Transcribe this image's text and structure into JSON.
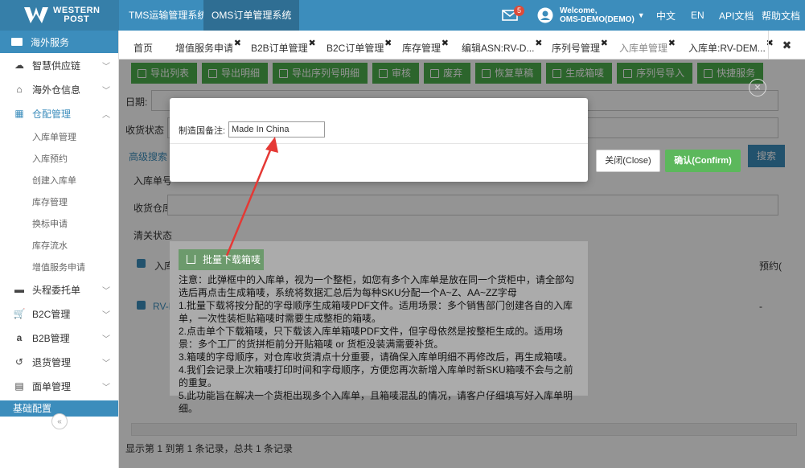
{
  "header": {
    "logo_line1": "WESTERN",
    "logo_line2": "POST",
    "systems": [
      "TMS运输管理系统",
      "OMS订单管理系统"
    ],
    "notification_count": "5",
    "welcome": "Welcome,",
    "user": "OMS-DEMO(DEMO)",
    "lang_zh": "中文",
    "lang_en": "EN",
    "api_docs": "API文档",
    "help_docs": "帮助文档"
  },
  "sidebar": {
    "head": "海外服务",
    "items": [
      {
        "label": "智慧供应链",
        "icon": "cloud-icon"
      },
      {
        "label": "海外仓信息",
        "icon": "home-icon"
      },
      {
        "label": "仓配管理",
        "icon": "grid-icon"
      }
    ],
    "sub_items": [
      "入库单管理",
      "入库预约",
      "创建入库单",
      "库存管理",
      "换标申请",
      "库存流水",
      "增值服务申请"
    ],
    "items2": [
      {
        "label": "头程委托单",
        "icon": "briefcase-icon"
      },
      {
        "label": "B2C管理",
        "icon": "cart-icon"
      },
      {
        "label": "B2B管理",
        "icon": "amazon-icon"
      },
      {
        "label": "退货管理",
        "icon": "return-icon"
      },
      {
        "label": "面单管理",
        "icon": "document-icon"
      }
    ],
    "bottom": "基础配置",
    "collapse": "«"
  },
  "tabs": {
    "items": [
      "首页",
      "增值服务申请",
      "B2B订单管理",
      "B2C订单管理",
      "库存管理",
      "编辑ASN:RV-D...",
      "序列号管理",
      "入库单管理",
      "入库单:RV-DEM..."
    ],
    "close_all": "✖"
  },
  "toolbar": {
    "buttons": [
      "导出列表",
      "导出明细",
      "导出序列号明细",
      "审核",
      "废弃",
      "恢复草稿",
      "生成箱唛",
      "序列号导入",
      "快捷服务"
    ]
  },
  "form": {
    "date_label": "日期:",
    "receive_status_label": "收货状态",
    "advanced_search": "高级搜索",
    "inbound_no_label": "入库单号",
    "warehouse_label": "收货仓库",
    "clearance_label": "清关状态",
    "search": "搜索",
    "col_inbound": "入库",
    "col_reserve": "预约(",
    "row_prefix": "RV-D",
    "row_dash": "-"
  },
  "bulk_download": "批量下载箱唛",
  "notes": [
    "注意：此弹框中的入库单，视为一个整柜，如您有多个入库单是放在同一个货柜中，请全部勾选后再点击生成箱唛，系统将数据汇总后为每种SKU分配一个A~Z、AA~ZZ字母",
    "1.批量下载将按分配的字母顺序生成箱唛PDF文件。适用场景：多个销售部门创建各自的入库单，一次性装柜贴箱唛时需要生成整柜的箱唛。",
    "2.点击单个下载箱唛，只下载该入库单箱唛PDF文件，但字母依然是按整柜生成的。适用场景：多个工厂的货拼柜前分开贴箱唛 or 货柜没装满需要补货。",
    "3.箱唛的字母顺序，对仓库收货清点十分重要，请确保入库单明细不再修改后，再生成箱唛。",
    "4.我们会记录上次箱唛打印时间和字母顺序，方便您再次新增入库单时新SKU箱唛不会与之前的重复。",
    "5.此功能旨在解决一个货柜出现多个入库单，且箱唛混乱的情况，请客户仔细填写好入库单明细。"
  ],
  "paging": "显示第 1 到第 1 条记录，总共 1 条记录",
  "modal": {
    "label": "制造国备注:",
    "input_value": "Made In China",
    "close_label": "关闭(Close)",
    "confirm_label": "确认(Confirm)",
    "x": "×"
  },
  "colors": {
    "header": "#3c8dbc",
    "green": "#5cb85c",
    "arrow": "#e53935"
  }
}
